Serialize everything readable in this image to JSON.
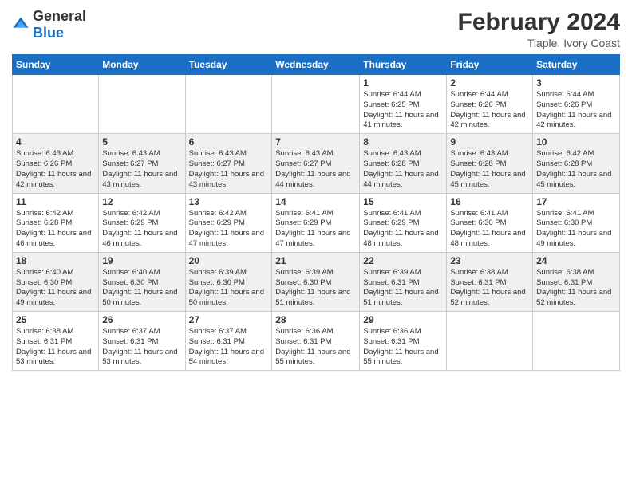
{
  "logo": {
    "general": "General",
    "blue": "Blue"
  },
  "header": {
    "title": "February 2024",
    "subtitle": "Tiaple, Ivory Coast"
  },
  "days_of_week": [
    "Sunday",
    "Monday",
    "Tuesday",
    "Wednesday",
    "Thursday",
    "Friday",
    "Saturday"
  ],
  "weeks": [
    [
      {
        "day": "",
        "info": ""
      },
      {
        "day": "",
        "info": ""
      },
      {
        "day": "",
        "info": ""
      },
      {
        "day": "",
        "info": ""
      },
      {
        "day": "1",
        "info": "Sunrise: 6:44 AM\nSunset: 6:25 PM\nDaylight: 11 hours and 41 minutes."
      },
      {
        "day": "2",
        "info": "Sunrise: 6:44 AM\nSunset: 6:26 PM\nDaylight: 11 hours and 42 minutes."
      },
      {
        "day": "3",
        "info": "Sunrise: 6:44 AM\nSunset: 6:26 PM\nDaylight: 11 hours and 42 minutes."
      }
    ],
    [
      {
        "day": "4",
        "info": "Sunrise: 6:43 AM\nSunset: 6:26 PM\nDaylight: 11 hours and 42 minutes."
      },
      {
        "day": "5",
        "info": "Sunrise: 6:43 AM\nSunset: 6:27 PM\nDaylight: 11 hours and 43 minutes."
      },
      {
        "day": "6",
        "info": "Sunrise: 6:43 AM\nSunset: 6:27 PM\nDaylight: 11 hours and 43 minutes."
      },
      {
        "day": "7",
        "info": "Sunrise: 6:43 AM\nSunset: 6:27 PM\nDaylight: 11 hours and 44 minutes."
      },
      {
        "day": "8",
        "info": "Sunrise: 6:43 AM\nSunset: 6:28 PM\nDaylight: 11 hours and 44 minutes."
      },
      {
        "day": "9",
        "info": "Sunrise: 6:43 AM\nSunset: 6:28 PM\nDaylight: 11 hours and 45 minutes."
      },
      {
        "day": "10",
        "info": "Sunrise: 6:42 AM\nSunset: 6:28 PM\nDaylight: 11 hours and 45 minutes."
      }
    ],
    [
      {
        "day": "11",
        "info": "Sunrise: 6:42 AM\nSunset: 6:28 PM\nDaylight: 11 hours and 46 minutes."
      },
      {
        "day": "12",
        "info": "Sunrise: 6:42 AM\nSunset: 6:29 PM\nDaylight: 11 hours and 46 minutes."
      },
      {
        "day": "13",
        "info": "Sunrise: 6:42 AM\nSunset: 6:29 PM\nDaylight: 11 hours and 47 minutes."
      },
      {
        "day": "14",
        "info": "Sunrise: 6:41 AM\nSunset: 6:29 PM\nDaylight: 11 hours and 47 minutes."
      },
      {
        "day": "15",
        "info": "Sunrise: 6:41 AM\nSunset: 6:29 PM\nDaylight: 11 hours and 48 minutes."
      },
      {
        "day": "16",
        "info": "Sunrise: 6:41 AM\nSunset: 6:30 PM\nDaylight: 11 hours and 48 minutes."
      },
      {
        "day": "17",
        "info": "Sunrise: 6:41 AM\nSunset: 6:30 PM\nDaylight: 11 hours and 49 minutes."
      }
    ],
    [
      {
        "day": "18",
        "info": "Sunrise: 6:40 AM\nSunset: 6:30 PM\nDaylight: 11 hours and 49 minutes."
      },
      {
        "day": "19",
        "info": "Sunrise: 6:40 AM\nSunset: 6:30 PM\nDaylight: 11 hours and 50 minutes."
      },
      {
        "day": "20",
        "info": "Sunrise: 6:39 AM\nSunset: 6:30 PM\nDaylight: 11 hours and 50 minutes."
      },
      {
        "day": "21",
        "info": "Sunrise: 6:39 AM\nSunset: 6:30 PM\nDaylight: 11 hours and 51 minutes."
      },
      {
        "day": "22",
        "info": "Sunrise: 6:39 AM\nSunset: 6:31 PM\nDaylight: 11 hours and 51 minutes."
      },
      {
        "day": "23",
        "info": "Sunrise: 6:38 AM\nSunset: 6:31 PM\nDaylight: 11 hours and 52 minutes."
      },
      {
        "day": "24",
        "info": "Sunrise: 6:38 AM\nSunset: 6:31 PM\nDaylight: 11 hours and 52 minutes."
      }
    ],
    [
      {
        "day": "25",
        "info": "Sunrise: 6:38 AM\nSunset: 6:31 PM\nDaylight: 11 hours and 53 minutes."
      },
      {
        "day": "26",
        "info": "Sunrise: 6:37 AM\nSunset: 6:31 PM\nDaylight: 11 hours and 53 minutes."
      },
      {
        "day": "27",
        "info": "Sunrise: 6:37 AM\nSunset: 6:31 PM\nDaylight: 11 hours and 54 minutes."
      },
      {
        "day": "28",
        "info": "Sunrise: 6:36 AM\nSunset: 6:31 PM\nDaylight: 11 hours and 55 minutes."
      },
      {
        "day": "29",
        "info": "Sunrise: 6:36 AM\nSunset: 6:31 PM\nDaylight: 11 hours and 55 minutes."
      },
      {
        "day": "",
        "info": ""
      },
      {
        "day": "",
        "info": ""
      }
    ]
  ]
}
